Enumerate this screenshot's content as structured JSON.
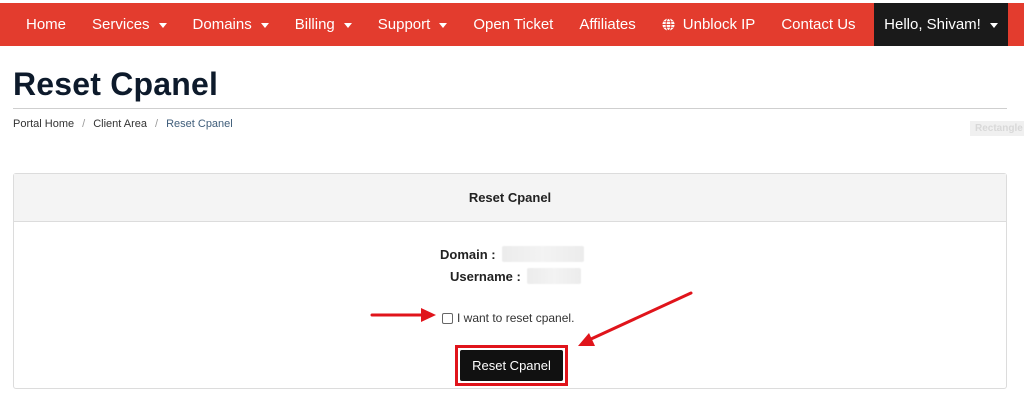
{
  "nav": {
    "items": [
      {
        "label": "Home",
        "dropdown": false
      },
      {
        "label": "Services",
        "dropdown": true
      },
      {
        "label": "Domains",
        "dropdown": true
      },
      {
        "label": "Billing",
        "dropdown": true
      },
      {
        "label": "Support",
        "dropdown": true
      },
      {
        "label": "Open Ticket",
        "dropdown": false
      },
      {
        "label": "Affiliates",
        "dropdown": false
      },
      {
        "label": "Unblock IP",
        "dropdown": false,
        "icon": "globe-icon"
      },
      {
        "label": "Contact Us",
        "dropdown": false
      }
    ],
    "user_label": "Hello, Shivam!",
    "bar_color": "#e33c2e",
    "user_color": "#1a1a1a"
  },
  "page": {
    "title": "Reset Cpanel"
  },
  "breadcrumb": {
    "items": [
      "Portal Home",
      "Client Area",
      "Reset Cpanel"
    ],
    "separator": "/"
  },
  "side_tag": "Rectangle",
  "panel": {
    "heading": "Reset Cpanel",
    "domain_label": "Domain :",
    "username_label": "Username :",
    "checkbox_label": "I want to reset cpanel.",
    "checkbox_checked": false,
    "button_label": "Reset Cpanel",
    "highlight_color": "#e0141b"
  }
}
